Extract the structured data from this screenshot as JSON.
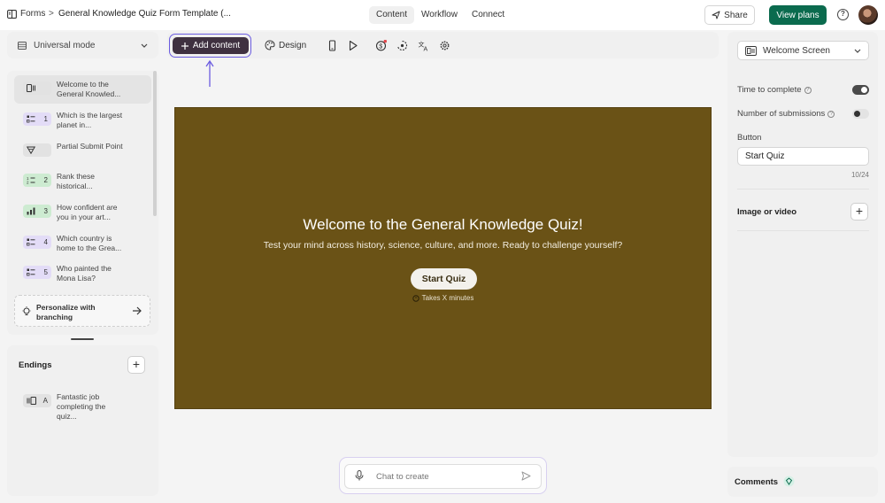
{
  "topbar": {
    "app_name": "Forms",
    "separator": ">",
    "form_title": "General Knowledge Quiz Form Template (...",
    "tabs": [
      {
        "label": "Content",
        "active": true
      },
      {
        "label": "Workflow",
        "active": false
      },
      {
        "label": "Connect",
        "active": false
      }
    ],
    "share_label": "Share",
    "view_plans_label": "View plans",
    "help_glyph": "?"
  },
  "left_panel": {
    "mode_label": "Universal mode",
    "questions": [
      {
        "icon": "welcome-screen-icon",
        "number": "",
        "text": "Welcome to the General Knowled...",
        "selected": true,
        "color": "#e2e2e2"
      },
      {
        "icon": "multiple-choice-icon",
        "number": "1",
        "text": "Which is the largest planet in...",
        "selected": false,
        "color": "#e3dcf7"
      },
      {
        "icon": "partial-submit-icon",
        "number": "",
        "text": "Partial Submit Point",
        "selected": false,
        "color": "#e2e2e2"
      },
      {
        "icon": "ranking-icon",
        "number": "2",
        "text": "Rank these historical...",
        "selected": false,
        "color": "#cdebd1"
      },
      {
        "icon": "opinion-scale-icon",
        "number": "3",
        "text": "How confident are you in your art...",
        "selected": false,
        "color": "#cdebd1"
      },
      {
        "icon": "multiple-choice-icon",
        "number": "4",
        "text": "Which country is home to the Grea...",
        "selected": false,
        "color": "#e3dcf7"
      },
      {
        "icon": "multiple-choice-icon",
        "number": "5",
        "text": "Who painted the Mona Lisa?",
        "selected": false,
        "color": "#e3dcf7"
      }
    ],
    "personalize_label": "Personalize with branching",
    "endings_title": "Endings",
    "endings": [
      {
        "icon": "ending-screen-icon",
        "letter": "A",
        "text": "Fantastic job completing the quiz...",
        "color": "#e2e2e2"
      }
    ]
  },
  "toolbar": {
    "add_content_label": "Add content",
    "design_label": "Design"
  },
  "canvas": {
    "background": "#6a5216",
    "title": "Welcome to the General Knowledge Quiz!",
    "subtitle": "Test your mind across history, science, culture, and more. Ready to challenge yourself?",
    "button_label": "Start Quiz",
    "time_text": "Takes X minutes"
  },
  "chat": {
    "placeholder": "Chat to create"
  },
  "right_panel": {
    "screen_type": "Welcome Screen",
    "time_to_complete_label": "Time to complete",
    "time_to_complete_on": true,
    "submissions_label": "Number of submissions",
    "submissions_on": false,
    "button_section_label": "Button",
    "button_value": "Start Quiz",
    "button_counter": "10/24",
    "image_label": "Image or video",
    "comments_label": "Comments"
  },
  "colors": {
    "accent_purple": "#6b5ce0",
    "primary_green": "#0b6b4e",
    "add_button": "#3f3140"
  }
}
